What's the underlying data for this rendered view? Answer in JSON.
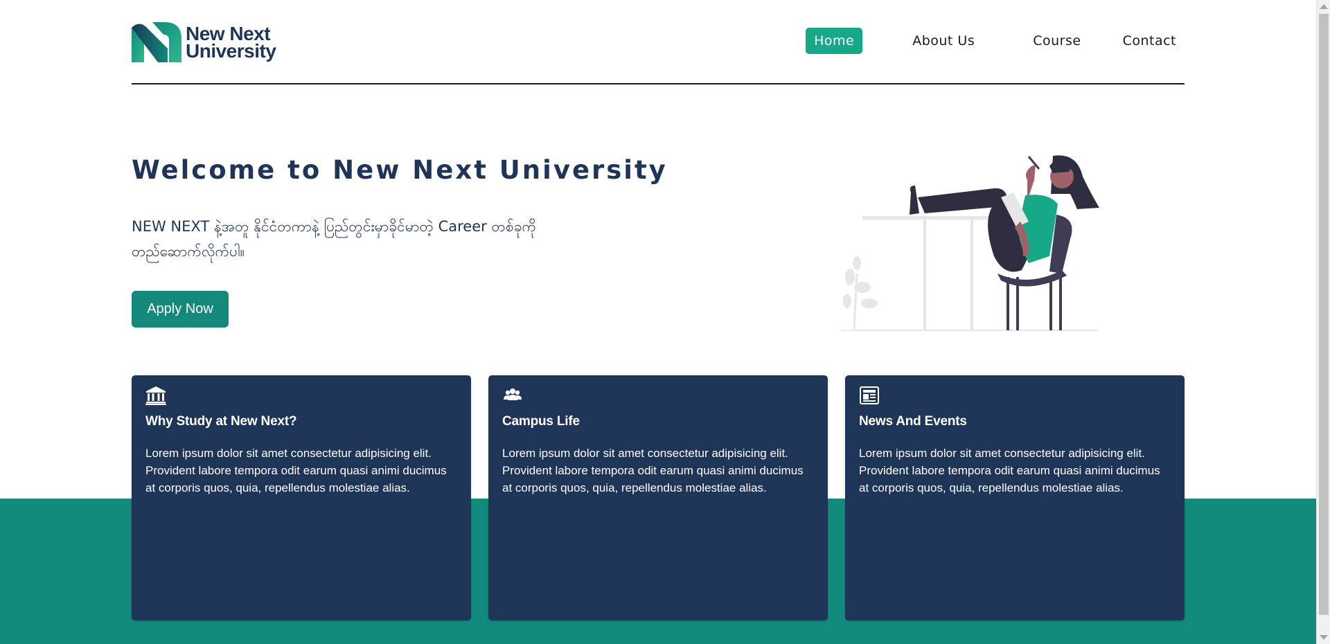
{
  "header": {
    "logo_line1": "New Next",
    "logo_line2": "University",
    "nav": [
      {
        "label": "Home",
        "active": true
      },
      {
        "label": "About Us",
        "active": false
      },
      {
        "label": "Course",
        "active": false
      },
      {
        "label": "Contact",
        "active": false
      }
    ]
  },
  "hero": {
    "title": "Welcome to New Next University",
    "subtitle": "NEW NEXT နဲ့အတူ နိုင်ငံတကာနဲ့ ပြည်တွင်းမှာခိုင်မာတဲ့ Career တစ်ခုကို တည်ဆောက်လိုက်ပါ။",
    "apply_label": "Apply Now"
  },
  "cards": [
    {
      "icon": "university-icon",
      "title": "Why Study at New Next?",
      "body": "Lorem ipsum dolor sit amet consectetur adipisicing elit. Provident labore tempora odit earum quasi animi ducimus at corporis quos, quia, repellendus molestiae alias."
    },
    {
      "icon": "users-icon",
      "title": "Campus Life",
      "body": "Lorem ipsum dolor sit amet consectetur adipisicing elit. Provident labore tempora odit earum quasi animi ducimus at corporis quos, quia, repellendus molestiae alias."
    },
    {
      "icon": "newspaper-icon",
      "title": "News And Events",
      "body": "Lorem ipsum dolor sit amet consectetur adipisicing elit. Provident labore tempora odit earum quasi animi ducimus at corporis quos, quia, repellendus molestiae alias."
    }
  ],
  "colors": {
    "navy": "#1e3557",
    "brand_green": "#17a987",
    "teal": "#128a7b",
    "button": "#14897a"
  }
}
